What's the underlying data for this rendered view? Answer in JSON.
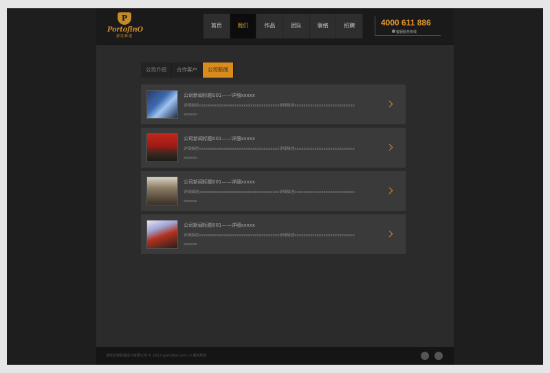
{
  "logo": {
    "brand": "PortofinO",
    "sub": "波托菲诺",
    "mark": "P"
  },
  "nav": {
    "items": [
      {
        "label": "首页",
        "active": false
      },
      {
        "label": "我们",
        "active": true
      },
      {
        "label": "作品",
        "active": false
      },
      {
        "label": "团队",
        "active": false
      },
      {
        "label": "联络",
        "active": false
      },
      {
        "label": "招聘",
        "active": false
      }
    ]
  },
  "hotline": {
    "number": "4000 611 886",
    "caption": "客服服务热线"
  },
  "tabs": [
    {
      "label": "公司介绍",
      "active": false
    },
    {
      "label": "合作客户",
      "active": false
    },
    {
      "label": "公司新闻",
      "active": true
    }
  ],
  "news": [
    {
      "title": "公司新闻标题001——详细xxxxx",
      "desc": "详细描述xxxxxxxxxxxxxxxxxxxxxxxxxxxxxxxxxxxx详细描述xxxxxxxxxxxxxxxxxxxxxxxxxxxxxxxxx"
    },
    {
      "title": "公司新闻标题001——详细xxxxx",
      "desc": "详细描述xxxxxxxxxxxxxxxxxxxxxxxxxxxxxxxxxxxx详细描述xxxxxxxxxxxxxxxxxxxxxxxxxxxxxxxxx"
    },
    {
      "title": "公司新闻标题001——详细xxxxx",
      "desc": "详细描述xxxxxxxxxxxxxxxxxxxxxxxxxxxxxxxxxxxx详细描述xxxxxxxxxxxxxxxxxxxxxxxxxxxxxxxxx"
    },
    {
      "title": "公司新闻标题001——详细xxxxx",
      "desc": "详细描述xxxxxxxxxxxxxxxxxxxxxxxxxxxxxxxxxxxx详细描述xxxxxxxxxxxxxxxxxxxxxxxxxxxxxxxxx"
    }
  ],
  "footer": {
    "copyright": "波托菲诺影视设计有限公司   © 2013 portofino.com.cn 版权所有"
  },
  "social": [
    "weibo-icon",
    "wechat-icon"
  ],
  "colors": {
    "accent": "#d98b1c",
    "hotline": "#e6972a"
  }
}
